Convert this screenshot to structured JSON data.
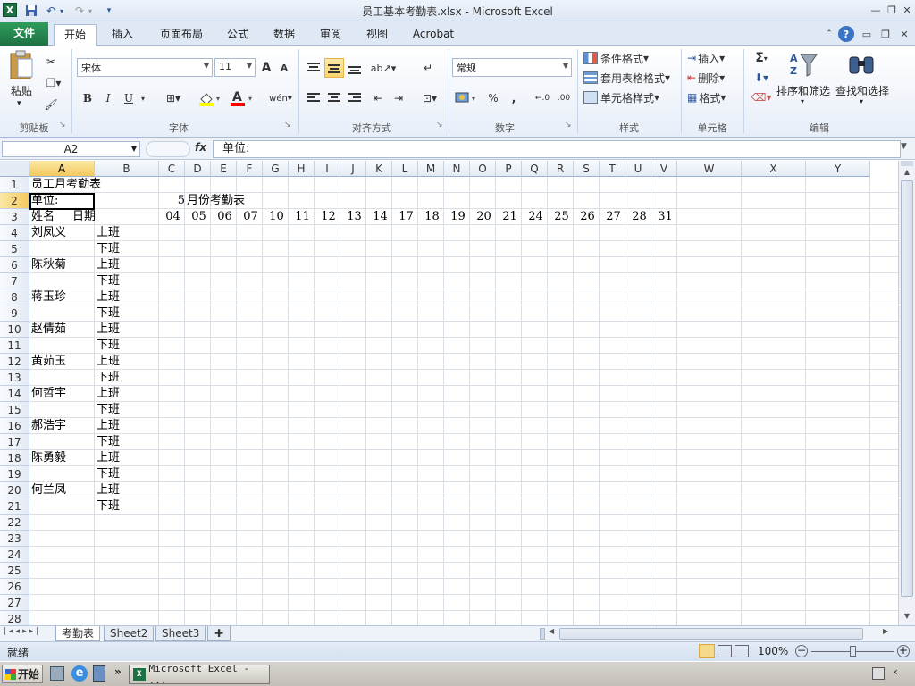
{
  "window": {
    "title": "员工基本考勤表.xlsx  -  Microsoft Excel",
    "app_icon": "excel-icon",
    "qa_dropdown": "▾"
  },
  "ribbon_tabs": [
    "文件",
    "开始",
    "插入",
    "页面布局",
    "公式",
    "数据",
    "审阅",
    "视图",
    "Acrobat"
  ],
  "ribbon": {
    "clipboard": {
      "label": "剪贴板",
      "paste": "粘贴"
    },
    "font": {
      "label": "字体",
      "font_name": "宋体",
      "font_size": "11",
      "bold": "B",
      "italic": "I",
      "underline": "U",
      "grow": "A",
      "shrink": "A",
      "font_color": "A",
      "wen": "wén"
    },
    "alignment": {
      "label": "对齐方式"
    },
    "number": {
      "label": "数字",
      "format": "常规",
      "percent": "%",
      "comma": ","
    },
    "styles": {
      "label": "样式",
      "conditional": "条件格式",
      "table": "套用表格格式",
      "cell_styles": "单元格样式"
    },
    "cells": {
      "label": "单元格",
      "insert": "插入",
      "delete": "删除",
      "format": "格式"
    },
    "editing": {
      "label": "编辑",
      "sigma": "Σ",
      "sort": "排序和筛选",
      "find": "查找和选择"
    }
  },
  "formula_bar": {
    "name_box": "A2",
    "fx": "fx",
    "content": "单位:"
  },
  "columns": [
    "A",
    "B",
    "C",
    "D",
    "E",
    "F",
    "G",
    "H",
    "I",
    "J",
    "K",
    "L",
    "M",
    "N",
    "O",
    "P",
    "Q",
    "R",
    "S",
    "T",
    "U",
    "V",
    "W",
    "X",
    "Y"
  ],
  "rows": [
    "1",
    "2",
    "3",
    "4",
    "5",
    "6",
    "7",
    "8",
    "9",
    "10",
    "11",
    "12",
    "13",
    "14",
    "15",
    "16",
    "17",
    "18",
    "19",
    "20",
    "21",
    "22",
    "23",
    "24",
    "25",
    "26",
    "27",
    "28"
  ],
  "cells": {
    "title": "员工月考勤表",
    "unit": "单位:",
    "month_num": "5",
    "month_label": "月份考勤表",
    "name_header": "姓名",
    "date_header": "日期",
    "dates": [
      "04",
      "05",
      "06",
      "07",
      "10",
      "11",
      "12",
      "13",
      "14",
      "17",
      "18",
      "19",
      "20",
      "21",
      "24",
      "25",
      "26",
      "27",
      "28",
      "31"
    ],
    "employees": [
      "刘凤义",
      "陈秋菊",
      "蒋玉珍",
      "赵倩茹",
      "黄茹玉",
      "何哲宇",
      "郝浩宇",
      "陈勇毅",
      "何兰凤"
    ],
    "shift_on": "上班",
    "shift_off": "下班"
  },
  "sheets": [
    "考勤表",
    "Sheet2",
    "Sheet3"
  ],
  "status": {
    "ready": "就绪",
    "zoom": "100%"
  },
  "taskbar": {
    "start": "开始",
    "excel_task": "Microsoft Excel - ...",
    "chevron": "»"
  }
}
